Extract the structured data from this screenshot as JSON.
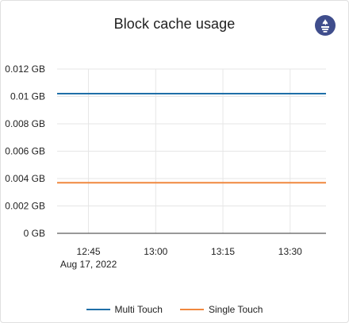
{
  "panel": {
    "title": "Block cache usage",
    "logo_icon": "prometheus-icon"
  },
  "chart_data": {
    "type": "line",
    "title": "Block cache usage",
    "x_ticks": [
      "12:45",
      "13:00",
      "13:15",
      "13:30"
    ],
    "x_date_label": "Aug 17, 2022",
    "y_ticks": [
      "0 GB",
      "0.002 GB",
      "0.004 GB",
      "0.006 GB",
      "0.008 GB",
      "0.01 GB",
      "0.012 GB"
    ],
    "y_unit": "GB",
    "ylim": [
      0,
      0.012
    ],
    "grid": "vertical and horizontal",
    "x": [
      "12:38",
      "12:45",
      "13:00",
      "13:15",
      "13:30",
      "13:38"
    ],
    "series": [
      {
        "name": "Multi Touch",
        "color": "#1f6fa8",
        "values": [
          0.0102,
          0.0102,
          0.0102,
          0.0102,
          0.0102,
          0.0102
        ]
      },
      {
        "name": "Single Touch",
        "color": "#f0883e",
        "values": [
          0.0037,
          0.0037,
          0.0037,
          0.0037,
          0.0037,
          0.0037
        ]
      }
    ],
    "legend_position": "bottom-center"
  }
}
